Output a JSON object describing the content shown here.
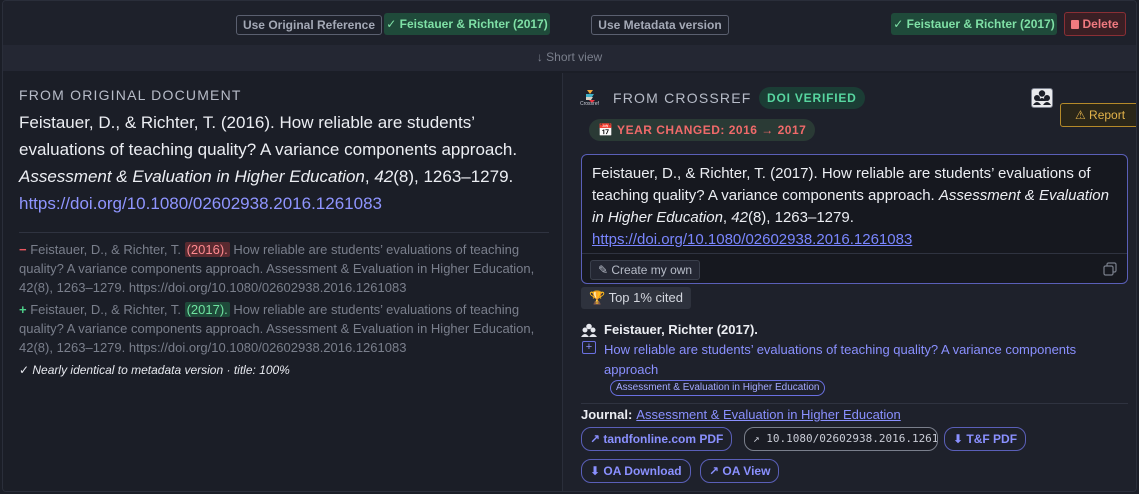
{
  "topbar": {
    "use_original_label": "Use Original Reference",
    "use_original_selected": "✓ Feistauer & Richter (2017)",
    "use_metadata_label": "Use Metadata version",
    "use_metadata_selected": "✓ Feistauer & Richter (2017)",
    "delete_label": "Delete",
    "short_view_label": "↓ Short view"
  },
  "original": {
    "title": "FROM ORIGINAL DOCUMENT",
    "ref_text": "Feistauer, D., & Richter, T. (2016). How reliable are students’ evaluations of teaching quality? A variance components approach. ",
    "ref_journal": "Assessment & Evaluation in Higher Education",
    "ref_sep": ", ",
    "ref_volume": "42",
    "ref_pages": "(8), 1263–1279.",
    "ref_doi": "https://doi.org/10.1080/02602938.2016.1261083",
    "diff_removed": {
      "sign": "−",
      "prefix": " Feistauer, D., & Richter, T. ",
      "changed": "(2016).",
      "suffix": " How reliable are students’ evaluations of teaching quality? A variance components approach. Assessment & Evaluation in Higher Education, 42(8), 1263–1279. https://doi.org/10.1080/02602938.2016.1261083"
    },
    "diff_added": {
      "sign": "+",
      "prefix": " Feistauer, D., & Richter, T. ",
      "changed": "(2017).",
      "suffix": " How reliable are students’ evaluations of teaching quality? A variance components approach. Assessment & Evaluation in Higher Education, 42(8), 1263–1279. https://doi.org/10.1080/02602938.2016.1261083"
    },
    "note": "✓ Nearly identical to metadata version · title: 100%"
  },
  "crossref": {
    "logo_text": "Crossref",
    "title": "FROM CROSSREF",
    "doi_badge": "DOI VERIFIED",
    "year_badge": "📅 YEAR CHANGED: 2016 → 2017",
    "report_label": "⚠ Report",
    "ref_text": "Feistauer, D., & Richter, T. (2017). How reliable are students’ evaluations of teaching quality? A variance components approach. ",
    "ref_journal": "Assessment & Evaluation in Higher Education",
    "ref_sep": ", ",
    "ref_volume": "42",
    "ref_pages": "(8), 1263–1279.",
    "ref_doi": "https://doi.org/10.1080/02602938.2016.1261083",
    "create_label": "✎ Create my own",
    "top_cited": "🏆 Top 1% cited",
    "authors": "Feistauer, Richter (2017).",
    "plus": "+",
    "article_title": "How reliable are students’ evaluations of teaching quality? A variance components approach",
    "journal_chip": "Assessment & Evaluation in Higher Education",
    "journal_label": "Journal:",
    "journal_name": "Assessment & Evaluation in Higher Education",
    "links": {
      "tandfonline": "↗ tandfonline.com PDF",
      "doi": "↗ 10.1080/02602938.2016.1261083",
      "tf_pdf": "⬇ T&F PDF",
      "oa_download": "⬇ OA Download",
      "oa_view": "↗ OA View"
    }
  },
  "colors": {
    "accent": "#8a90ff",
    "removed": "#e8565f",
    "added": "#4dd08a",
    "warning": "#e2b24a"
  }
}
